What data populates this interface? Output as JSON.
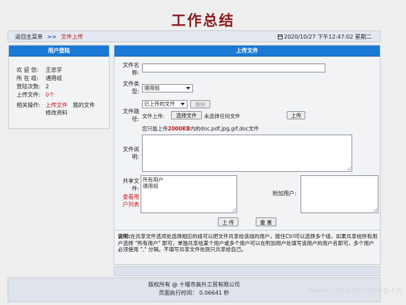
{
  "title": "工作总结",
  "breadcrumb": {
    "back": "返回主菜单",
    "separator": ">>",
    "current": "文件上传"
  },
  "datetime": "2020/10/27 下午12:47:02 星期二",
  "user_panel": {
    "header": "用户登陆",
    "rows": [
      {
        "key": "欢 迎 您:",
        "value": "王忠学"
      },
      {
        "key": "所 在 组:",
        "value": "通用组"
      },
      {
        "key": "登陆次数:",
        "value": "2"
      },
      {
        "key": "上传文件:",
        "value": "0个"
      }
    ],
    "actions_label": "相关操作:",
    "actions": {
      "upload": "上传文件",
      "my_files": "我的文件",
      "edit_profile": "修改资料"
    }
  },
  "upload_panel": {
    "header": "上传文件",
    "filename_label": "文件名称:",
    "filename_value": "",
    "filetype_label": "文件类型:",
    "filetype_selected": "通用组",
    "filepath_label": "文件路径:",
    "uploaded_select": "已上传的文件",
    "delete_button": "删除",
    "file_upload_label": "文件上传:",
    "choose_file_button": "选择文件",
    "no_file_text": "未选择任何文件",
    "upload_small_button": "上传",
    "limit_hint_prefix": "您只能上传",
    "limit_hint_size": "2000KB",
    "limit_hint_suffix": "内的doc,pdf,jpg,gif,doc文件",
    "description_label": "文件说明:",
    "share_label": "共享文件:",
    "view_users_link": "查看用户列表",
    "share_options": [
      "所有用户",
      "通用组"
    ],
    "add_user_label": "附加用户:",
    "submit_button": "上 传",
    "reset_button": "重 置",
    "note_title": "说明:",
    "note_text": "在共享文件选项处选择相应的组可以把文件共享给该组的用户，按住Ctrl可以选择多个组，如果共享给所有用户选择 \"所有用户\" 即可，单独共享给某个用户或多个用户可以在附加用户处填写该用户的用户名即可，多个用户必须使用 \",\" 分隔。不填写共享文件处则只共享给自己。"
  },
  "footer": {
    "copyright": "版权所有  @  十堰市高升工贸有限公司",
    "exec_time": "页面执行时间： 0.06641 秒"
  },
  "watermark": "www.sysgaosheng.cn"
}
